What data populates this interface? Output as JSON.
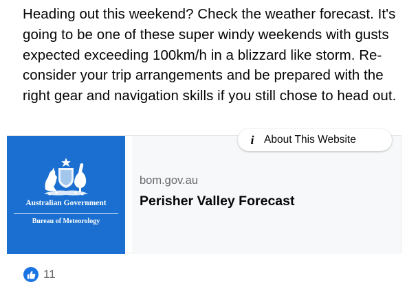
{
  "post": {
    "text": "Heading out this weekend? Check the weather forecast. It's going to be one of these super windy weekends with gusts expected exceeding 100km/h in a blizzard like storm. Re-consider your trip arrangements and be prepared with the right gear and navigation skills if you still chose to head out."
  },
  "link_card": {
    "thumbnail": {
      "org_name": "Australian Government",
      "agency_name": "Bureau of Meteorology",
      "brand_color": "#1a6fd0"
    },
    "domain": "bom.gov.au",
    "title": "Perisher Valley Forecast"
  },
  "about_website": {
    "label": "About This Website",
    "icon": "info-icon"
  },
  "reactions": {
    "icon": "like-icon",
    "count": "11",
    "accent_color": "#1b74e4"
  }
}
